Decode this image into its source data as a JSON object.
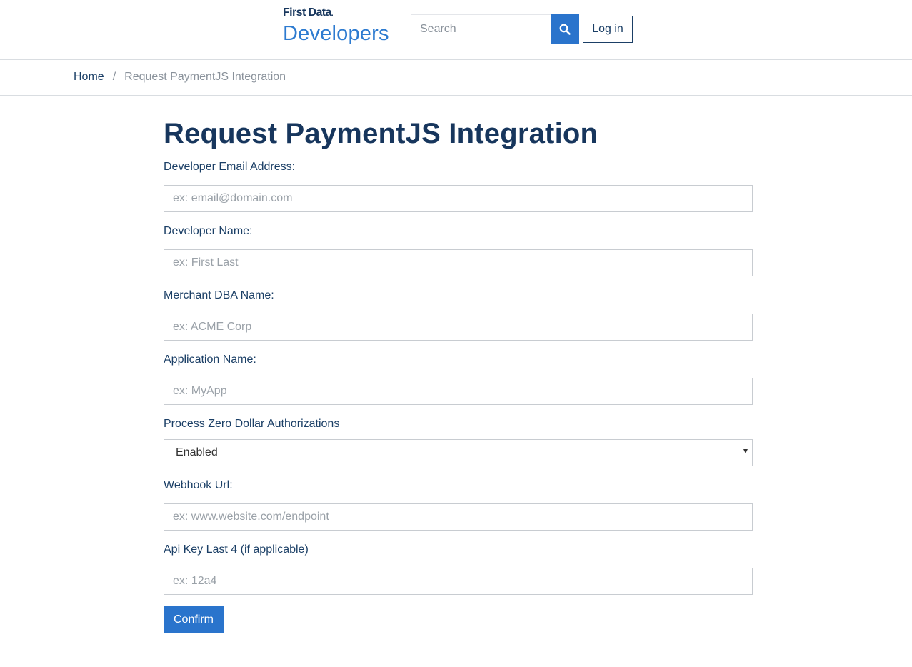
{
  "header": {
    "logo_top": "First Data",
    "logo_bottom": "Developers",
    "search_placeholder": "Search",
    "login_label": "Log in"
  },
  "breadcrumb": {
    "home": "Home",
    "separator": "/",
    "current": "Request PaymentJS Integration"
  },
  "form": {
    "title": "Request PaymentJS Integration",
    "email_label": "Developer Email Address:",
    "email_placeholder": "ex: email@domain.com",
    "name_label": "Developer Name:",
    "name_placeholder": "ex: First Last",
    "dba_label": "Merchant DBA Name:",
    "dba_placeholder": "ex: ACME Corp",
    "app_label": "Application Name:",
    "app_placeholder": "ex: MyApp",
    "zero_dollar_label": "Process Zero Dollar Authorizations",
    "zero_dollar_value": "Enabled",
    "webhook_label": "Webhook Url:",
    "webhook_placeholder": "ex: www.website.com/endpoint",
    "apikey_label": "Api Key Last 4 (if applicable)",
    "apikey_placeholder": "ex: 12a4",
    "confirm_label": "Confirm"
  },
  "colors": {
    "primary": "#2a74cc",
    "navy": "#17365d",
    "text": "#1b3f66",
    "muted": "#8a929b"
  },
  "icons": {
    "search": "search-icon",
    "select": "chevron-down-icon"
  }
}
